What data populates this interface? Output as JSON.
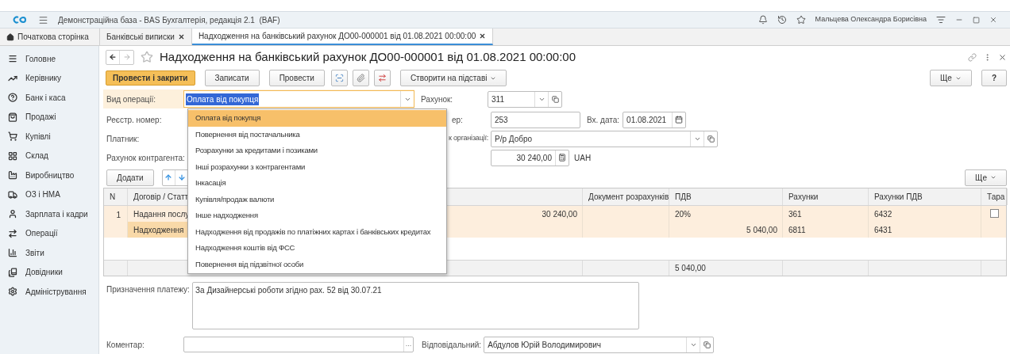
{
  "title_bar": {
    "app_title": "Демонстраційна база - BAS Бухгалтерія, редакція 2.1  (BAF)",
    "user": "Мальцева Олександра Борисівна"
  },
  "tabs": [
    {
      "label": "Початкова сторінка",
      "kind": "home",
      "selected": false
    },
    {
      "label": "Банківські виписки",
      "kind": "closable",
      "selected": false
    },
    {
      "label": "Надходження на банківський рахунок ДО00-000001 від 01.08.2021 00:00:00",
      "kind": "closable",
      "selected": true
    }
  ],
  "sidebar": [
    {
      "label": "Головне"
    },
    {
      "label": "Керівнику"
    },
    {
      "label": "Банк і каса"
    },
    {
      "label": "Продажі"
    },
    {
      "label": "Купівлі"
    },
    {
      "label": "Склад"
    },
    {
      "label": "Виробництво"
    },
    {
      "label": "ОЗ і НМА"
    },
    {
      "label": "Зарплата і кадри"
    },
    {
      "label": "Операції"
    },
    {
      "label": "Звіти"
    },
    {
      "label": "Довідники"
    },
    {
      "label": "Адміністрування"
    }
  ],
  "document": {
    "title": "Надходження на банківський рахунок ДО00-000001 від 01.08.2021 00:00:00",
    "toolbar": {
      "primary": "Провести і закрити",
      "buttons": [
        "Записати",
        "Провести"
      ],
      "create_based": "Створити на підставі",
      "more": "Ще",
      "help": "?"
    }
  },
  "form": {
    "operation_label": "Вид операції:",
    "operation_value": "Оплата від покупця",
    "account_label": "Рахунок:",
    "account_value": "311",
    "reg_label": "Реєстр. номер:",
    "in_number_label": "ер:",
    "in_number_value": "253",
    "in_date_label": "Вх. дата:",
    "in_date_value": "01.08.2021",
    "payer_label": "Платник:",
    "org_account_label": "к організації:",
    "org_account_value": "Р/р Добро",
    "counterparty_account_label": "Рахунок контрагента:",
    "amount_value": "30 240,00",
    "currency": "UAH"
  },
  "dropdown": {
    "items": [
      {
        "label": "Оплата від покупця",
        "selected": true
      },
      {
        "label": "Повернення від постачальника",
        "selected": false
      },
      {
        "label": "Розрахунки за кредитами і позиками",
        "selected": false
      },
      {
        "label": "Інші розрахунки з контрагентами",
        "selected": false
      },
      {
        "label": "Інкасація",
        "selected": false
      },
      {
        "label": "Купівля/продаж валюти",
        "selected": false
      },
      {
        "label": "Інше надходження",
        "selected": false
      },
      {
        "label": "Надходження від продажів по платіжних картах і банківських кредитах",
        "selected": false
      },
      {
        "label": "Надходження коштів від ФСС",
        "selected": false
      },
      {
        "label": "Повернення від підзвітної особи",
        "selected": false
      }
    ]
  },
  "table_toolbar": {
    "add": "Додати",
    "more": "Ще"
  },
  "table": {
    "columns": [
      "N",
      "Договір / Статт",
      "Документ розрахунків",
      "ПДВ",
      "Рахунки",
      "Рахунки ПДВ",
      "Тара"
    ],
    "rows": [
      {
        "n": "1",
        "tare_checked": false,
        "selected": true,
        "lines": [
          {
            "contract": "Надання послу",
            "amount": "30 240,00",
            "vat_rate": "20%",
            "accounts": "361",
            "vat_accounts": "6432"
          },
          {
            "contract": "Надходження",
            "vat_amount": "5 040,00",
            "accounts": "6811",
            "vat_accounts": "6431"
          }
        ]
      }
    ],
    "footer_vat": "5 040,00"
  },
  "payment_purpose": {
    "label": "Призначення платежу:",
    "value": "За Дизайнерські роботи згідно рах. 52 від 30.07.21"
  },
  "comment": {
    "label": "Коментар:",
    "more": "..."
  },
  "responsible": {
    "label": "Відповідальний:",
    "value": "Абдулов Юрій Володимирович"
  }
}
